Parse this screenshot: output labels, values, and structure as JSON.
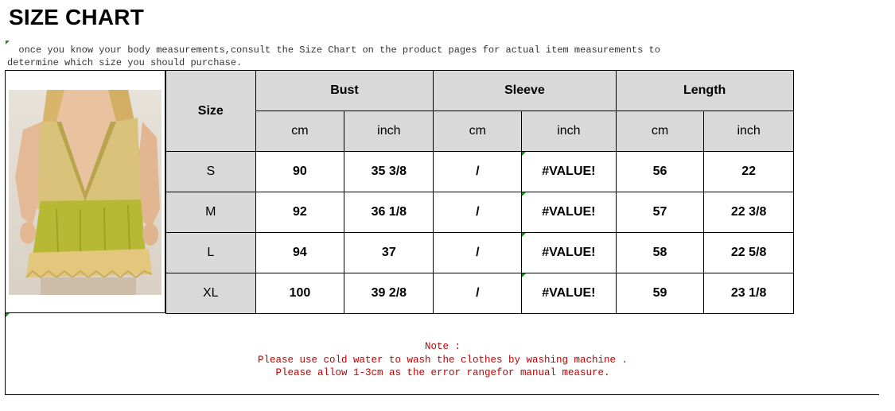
{
  "title": "SIZE CHART",
  "intro": {
    "line1": "  once you know your body measurements,consult the Size Chart on the product pages for actual item measurements to",
    "line2": "determine which size you should purchase."
  },
  "photo": {
    "description_icon": "model-wearing-top-photo"
  },
  "table": {
    "size_header": "Size",
    "groups": [
      "Bust",
      "Sleeve",
      "Length"
    ],
    "units": [
      "cm",
      "inch",
      "cm",
      "inch",
      "cm",
      "inch"
    ],
    "rows": [
      {
        "size": "S",
        "bust_cm": "90",
        "bust_inch": "35 3/8",
        "sleeve_cm": "/",
        "sleeve_inch": "#VALUE!",
        "length_cm": "56",
        "length_inch": "22"
      },
      {
        "size": "M",
        "bust_cm": "92",
        "bust_inch": "36 1/8",
        "sleeve_cm": "/",
        "sleeve_inch": "#VALUE!",
        "length_cm": "57",
        "length_inch": "22 3/8"
      },
      {
        "size": "L",
        "bust_cm": "94",
        "bust_inch": "37",
        "sleeve_cm": "/",
        "sleeve_inch": "#VALUE!",
        "length_cm": "58",
        "length_inch": "22 5/8"
      },
      {
        "size": "XL",
        "bust_cm": "100",
        "bust_inch": "39 2/8",
        "sleeve_cm": "/",
        "sleeve_inch": "#VALUE!",
        "length_cm": "59",
        "length_inch": "23 1/8"
      }
    ]
  },
  "note": {
    "heading": "Note :",
    "line1": "Please use cold water to wash the clothes by washing machine .",
    "line2": "Please allow 1-3cm as the error rangefor manual measure."
  },
  "colors": {
    "header_grey": "#d9d9d9",
    "note_red": "#c00000",
    "cell_marker_green": "#1a8a1a"
  }
}
